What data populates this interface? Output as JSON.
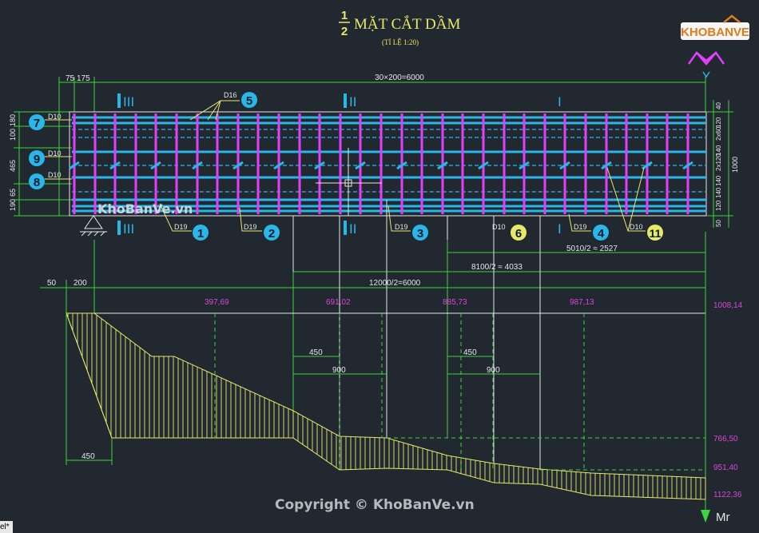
{
  "title": {
    "num": "1",
    "den": "2",
    "text": "MẶT CẮT DẦM",
    "scale": "(TỈ LỆ 1:20)"
  },
  "logo": "KHOBANVE",
  "watermark_mid": "KhoBanVe.vn",
  "watermark_bottom": "Copyright © KhoBanVe.vn",
  "tab_label": "el*",
  "dims": {
    "top_left_a": "75",
    "top_left_b": "175",
    "top_span": "30×200=6000",
    "left_100": "100",
    "left_180": "180",
    "left_465": "465",
    "left_190": "190",
    "left_65": "65",
    "right_40": "40",
    "right_120a": "120",
    "right_2x": "2x60",
    "right_140a": "140",
    "right_140b": "140",
    "right_2x_b": "2x120",
    "right_140c": "140",
    "right_120b": "120",
    "right_50": "50",
    "right_1000": "1000",
    "d5010": "5010/2 ≈ 2527",
    "d8100": "8100/2 ≈ 4033",
    "d12000": "12000/2=6000",
    "d50": "50",
    "d200": "200",
    "d450a": "450",
    "d900a": "900",
    "d450b": "450",
    "d900b": "900",
    "d450c": "450"
  },
  "sections": {
    "s3": "III",
    "s2": "II",
    "s1": "I"
  },
  "bars": [
    {
      "label": "D10",
      "num": "7"
    },
    {
      "label": "D10",
      "num": "9"
    },
    {
      "label": "D10",
      "num": "8"
    },
    {
      "label": "D16",
      "num": "5"
    },
    {
      "label": "D19",
      "num": "1"
    },
    {
      "label": "D19",
      "num": "2"
    },
    {
      "label": "D19",
      "num": "3"
    },
    {
      "label": "D10",
      "num": "6"
    },
    {
      "label": "D19",
      "num": "4"
    },
    {
      "label": "D10",
      "num": "11"
    }
  ],
  "moments_top": [
    "397,69",
    "691,02",
    "885,73",
    "987,13",
    "1008,14"
  ],
  "moments_right": [
    "766,50",
    "951,40",
    "1122,36"
  ],
  "axis_label": "Mr",
  "colors": {
    "bg": "#212830",
    "cyan": "#29b6e8",
    "magenta": "#e040fb",
    "yellow": "#e8e86a",
    "green": "#3cd63c",
    "white": "#e6e6e6",
    "moment": "#d946d9"
  }
}
